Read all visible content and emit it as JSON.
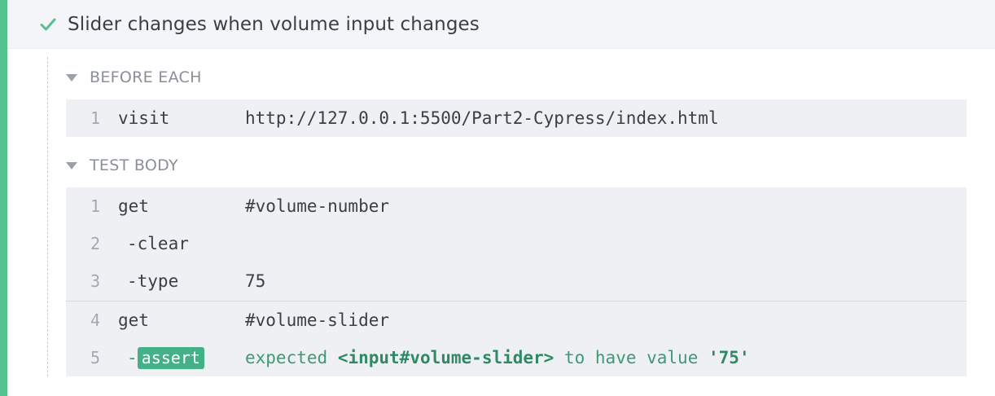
{
  "test": {
    "title": "Slider changes when volume input changes",
    "status": "passed",
    "status_color": "#55c18f"
  },
  "hooks": {
    "before_each": {
      "label": "BEFORE EACH",
      "commands": [
        {
          "num": "1",
          "name": "visit",
          "message": "http://127.0.0.1:5500/Part2-Cypress/index.html"
        }
      ]
    },
    "test_body": {
      "label": "TEST BODY",
      "commands": [
        {
          "num": "1",
          "name": "get",
          "message": "#volume-number"
        },
        {
          "num": "2",
          "name": "-clear",
          "message": ""
        },
        {
          "num": "3",
          "name": "-type",
          "message": "75"
        },
        {
          "num": "4",
          "name": "get",
          "message": "#volume-slider"
        },
        {
          "num": "5",
          "dash": "-",
          "name": "assert",
          "message_parts": [
            "expected",
            "<input#volume-slider>",
            "to have value",
            "'75'"
          ]
        }
      ]
    }
  },
  "icons": {
    "status": "check-icon",
    "collapse": "caret-down-icon"
  },
  "colors": {
    "pass_green": "#55c18f",
    "assert_green": "#43b087",
    "row_bg": "#eef0f3"
  }
}
